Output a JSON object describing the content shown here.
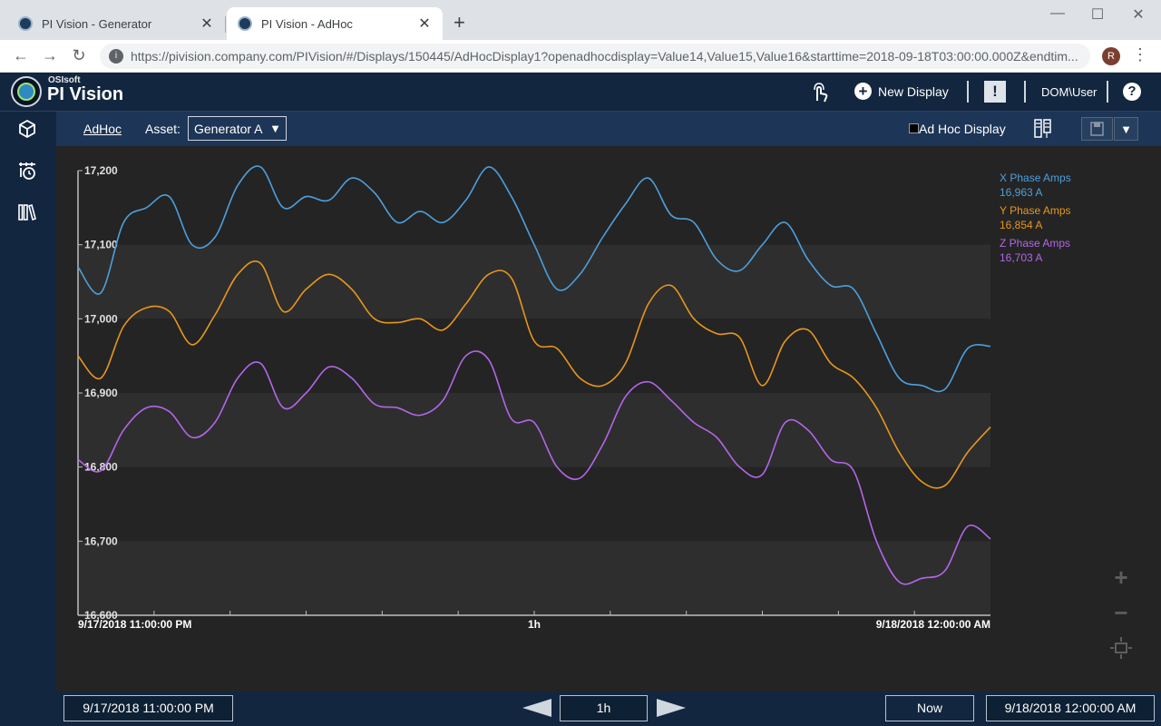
{
  "browser": {
    "tabs": [
      {
        "title": "PI Vision - Generator",
        "close": "✕",
        "active": false
      },
      {
        "title": "PI Vision - AdHoc",
        "close": "✕",
        "active": true
      }
    ],
    "new_tab": "+",
    "window_controls": {
      "minimize": "—",
      "maximize": "☐",
      "close": "✕"
    },
    "nav": {
      "back": "←",
      "forward": "→",
      "reload": "↻"
    },
    "url": "https://pivision.company.com/PIVision/#/Displays/150445/AdHocDisplay1?openadhocdisplay=Value14,Value15,Value16&starttime=2018-09-18T03:00:00.000Z&endtim...",
    "profile_initial": "R",
    "menu": "⋮"
  },
  "header": {
    "brand_small": "OSIsoft",
    "brand": "PI Vision",
    "new_display": "New Display",
    "alert": "!",
    "user": "DOM\\User",
    "help": "?"
  },
  "toolbar": {
    "adhoc_link": "AdHoc",
    "asset_label": "Asset:",
    "asset_value": "Generator A",
    "adhoc_display_label": "Ad Hoc Display",
    "more": "▼"
  },
  "zoom": {
    "in": "+",
    "out": "−"
  },
  "timebar": {
    "start": "9/17/2018 11:00:00 PM",
    "duration": "1h",
    "now": "Now",
    "end": "9/18/2018 12:00:00 AM"
  },
  "chart_data": {
    "type": "line",
    "ylim": [
      16600,
      17200
    ],
    "yticks": [
      "17,200",
      "17,100",
      "17,000",
      "16,900",
      "16,800",
      "16,700",
      "16,600"
    ],
    "ytick_values": [
      17200,
      17100,
      17000,
      16900,
      16800,
      16700,
      16600
    ],
    "x_start_label": "9/17/2018 11:00:00 PM",
    "x_mid_label": "1h",
    "x_end_label": "9/18/2018 12:00:00 AM",
    "x": [
      0,
      1.5,
      3,
      4.5,
      6,
      7.5,
      9,
      10.5,
      12,
      13.5,
      15,
      16.5,
      18,
      19.5,
      21,
      22.5,
      24,
      25.5,
      27,
      28.5,
      30,
      31.5,
      33,
      34.5,
      36,
      37.5,
      39,
      40.5,
      42,
      43.5,
      45,
      46.5,
      48,
      49.5,
      51,
      52.5,
      54,
      55.5,
      57,
      58.5,
      60
    ],
    "series": [
      {
        "name": "X Phase Amps",
        "color": "#4d9fdc",
        "current_value": "16,963 A",
        "values": [
          17070,
          17035,
          17130,
          17150,
          17165,
          17100,
          17110,
          17180,
          17205,
          17150,
          17165,
          17160,
          17190,
          17170,
          17130,
          17145,
          17130,
          17160,
          17205,
          17165,
          17100,
          17040,
          17060,
          17110,
          17155,
          17190,
          17140,
          17130,
          17080,
          17065,
          17100,
          17130,
          17080,
          17045,
          17040,
          16980,
          16920,
          16910,
          16905,
          16960,
          16963
        ]
      },
      {
        "name": "Y Phase Amps",
        "color": "#e8961e",
        "current_value": "16,854 A",
        "values": [
          16950,
          16920,
          16990,
          17015,
          17010,
          16965,
          17005,
          17060,
          17075,
          17010,
          17040,
          17060,
          17040,
          17000,
          16995,
          17000,
          16985,
          17020,
          17060,
          17055,
          16970,
          16960,
          16920,
          16910,
          16940,
          17020,
          17045,
          17000,
          16980,
          16975,
          16910,
          16970,
          16985,
          16940,
          16920,
          16880,
          16820,
          16780,
          16775,
          16820,
          16854
        ]
      },
      {
        "name": "Z Phase Amps",
        "color": "#b366e8",
        "current_value": "16,703 A",
        "values": [
          16810,
          16795,
          16850,
          16880,
          16875,
          16840,
          16860,
          16920,
          16940,
          16880,
          16900,
          16935,
          16920,
          16885,
          16880,
          16870,
          16890,
          16950,
          16945,
          16865,
          16860,
          16800,
          16785,
          16830,
          16895,
          16915,
          16890,
          16860,
          16840,
          16800,
          16790,
          16860,
          16850,
          16810,
          16795,
          16700,
          16645,
          16650,
          16660,
          16720,
          16703
        ]
      }
    ]
  }
}
